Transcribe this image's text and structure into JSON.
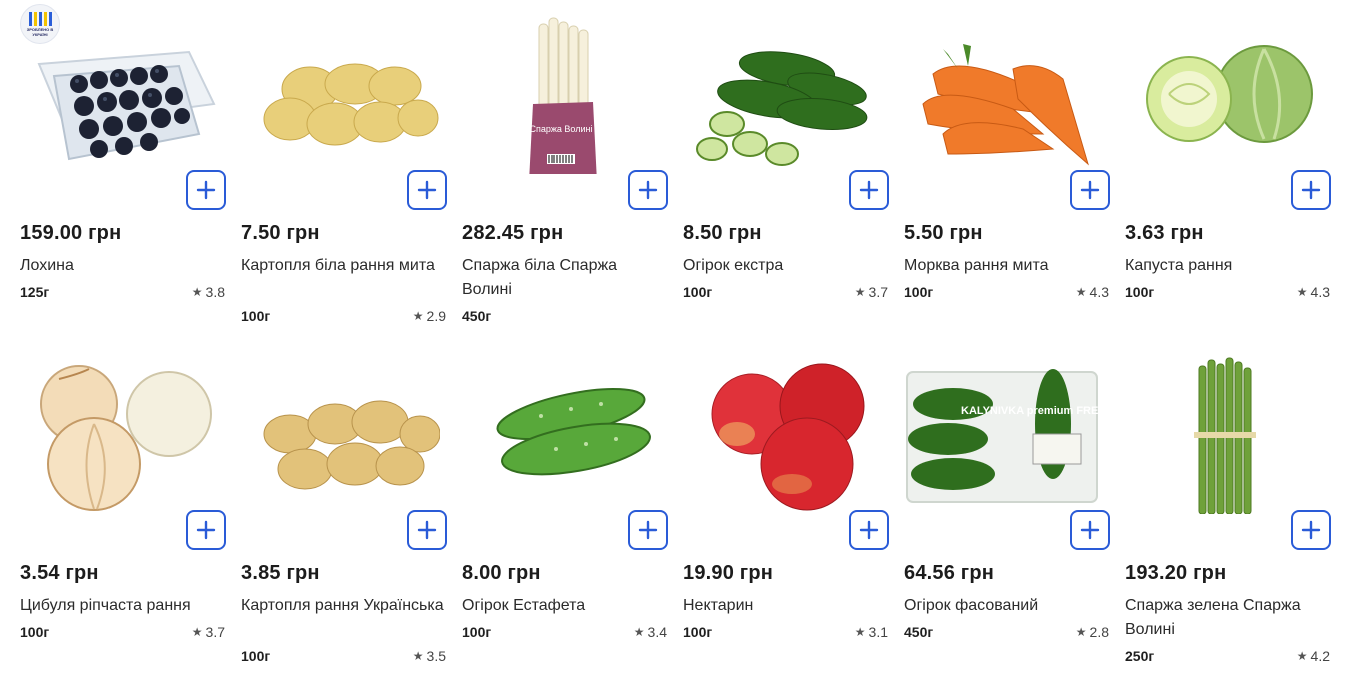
{
  "badge": {
    "text": "ЗРОБЛЕНО В УКРАЇНІ",
    "icon": "made-in-ukraine-icon"
  },
  "add_icon": "plus-icon",
  "rating_icon": "star-icon",
  "products": [
    {
      "price": "159.00 грн",
      "name": "Лохина",
      "weight": "125г",
      "rating": "3.8",
      "image": "blueberries"
    },
    {
      "price": "7.50 грн",
      "name": "Картопля біла рання мита",
      "weight": "100г",
      "rating": "2.9",
      "image": "potatoes-white"
    },
    {
      "price": "282.45 грн",
      "name": "Спаржа біла Спаржа Волині",
      "weight": "450г",
      "rating": "",
      "image": "white-asparagus",
      "label": "Спаржа Волині"
    },
    {
      "price": "8.50 грн",
      "name": "Огірок екстра",
      "weight": "100г",
      "rating": "3.7",
      "image": "cucumbers-sliced"
    },
    {
      "price": "5.50 грн",
      "name": "Морква рання мита",
      "weight": "100г",
      "rating": "4.3",
      "image": "carrots"
    },
    {
      "price": "3.63 грн",
      "name": "Капуста рання",
      "weight": "100г",
      "rating": "4.3",
      "image": "cabbage"
    },
    {
      "price": "3.54 грн",
      "name": "Цибуля ріпчаста рання",
      "weight": "100г",
      "rating": "3.7",
      "image": "onions"
    },
    {
      "price": "3.85 грн",
      "name": "Картопля рання Українська",
      "weight": "100г",
      "rating": "3.5",
      "image": "potatoes-young"
    },
    {
      "price": "8.00 грн",
      "name": "Огірок Естафета",
      "weight": "100г",
      "rating": "3.4",
      "image": "cucumbers"
    },
    {
      "price": "19.90 грн",
      "name": "Нектарин",
      "weight": "100г",
      "rating": "3.1",
      "image": "nectarines"
    },
    {
      "price": "64.56 грн",
      "name": "Огірок фасований",
      "weight": "450г",
      "rating": "2.8",
      "image": "packed-cucumbers",
      "label": "KALYNIVKA premium FRESH & TASTY"
    },
    {
      "price": "193.20 грн",
      "name": "Спаржа зелена Спаржа Волині",
      "weight": "250г",
      "rating": "4.2",
      "image": "green-asparagus"
    }
  ],
  "colors": {
    "accent": "#2a5bd7",
    "text": "#1f1f1f"
  }
}
